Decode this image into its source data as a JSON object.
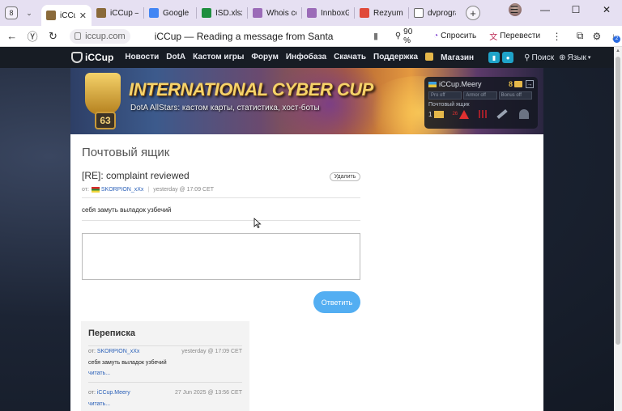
{
  "browser": {
    "tab_counter": "8",
    "tabs": [
      {
        "title": "iCCup",
        "color": "#8a6a3a",
        "active": true
      },
      {
        "title": "iCCup —",
        "color": "#8a6a3a"
      },
      {
        "title": "Google I",
        "color": "#4285f4"
      },
      {
        "title": "ISD.xlsx",
        "color": "#1e8e3e"
      },
      {
        "title": "Whois ce",
        "color": "#9b6bb8"
      },
      {
        "title": "InnboxG",
        "color": "#9b6bb8"
      },
      {
        "title": "Rezyume",
        "color": "#e04a3a"
      },
      {
        "title": "dvprogra",
        "color": "#666666"
      }
    ],
    "url": "iccup.com",
    "page_title": "iCCup — Reading a message from Santa",
    "zoom": "90 %",
    "ask_label": "Спросить",
    "translate_label": "Перевести",
    "downloads_badge": "2"
  },
  "site": {
    "logo": "iCCup",
    "nav": [
      "Новости",
      "DotA",
      "Кастом игры",
      "Форум",
      "Инфобаза",
      "Скачать",
      "Поддержка",
      "Магазин"
    ],
    "search_label": "Поиск",
    "lang_label": "Язык",
    "banner": {
      "level": "63",
      "title": "INTERNATIONAL CYBER CUP",
      "subtitle": "DotA AllStars: кастом карты, статистика, хост-боты"
    },
    "user": {
      "name": "iCCup.Meery",
      "gold": "8",
      "fields": [
        "Pro off",
        "Armor off",
        "Bonus off"
      ],
      "mailbox_label": "Почтовый ящик",
      "mail_count": "1",
      "alert_count": "26"
    }
  },
  "mailbox": {
    "heading": "Почтовый ящик",
    "subject": "[RE]: complaint reviewed",
    "delete_label": "Удалить",
    "from_prefix": "от:",
    "author": "SKORPION_xXx",
    "date": "yesterday @ 17:09 CET",
    "body": "себя замуть выладок узбечий",
    "reply_value": "",
    "reply_button": "Ответить"
  },
  "thread": {
    "title": "Переписка",
    "items": [
      {
        "from_prefix": "от:",
        "who": "SKORPION_xXx",
        "date": "yesterday @ 17:09 CET",
        "text": "себя замуть выладок узбечий",
        "read": "читать..."
      },
      {
        "from_prefix": "от:",
        "who": "iCCup.Meery",
        "date": "27 Jun 2025 @ 13:56 CET",
        "text": "",
        "read": "читать..."
      }
    ]
  }
}
